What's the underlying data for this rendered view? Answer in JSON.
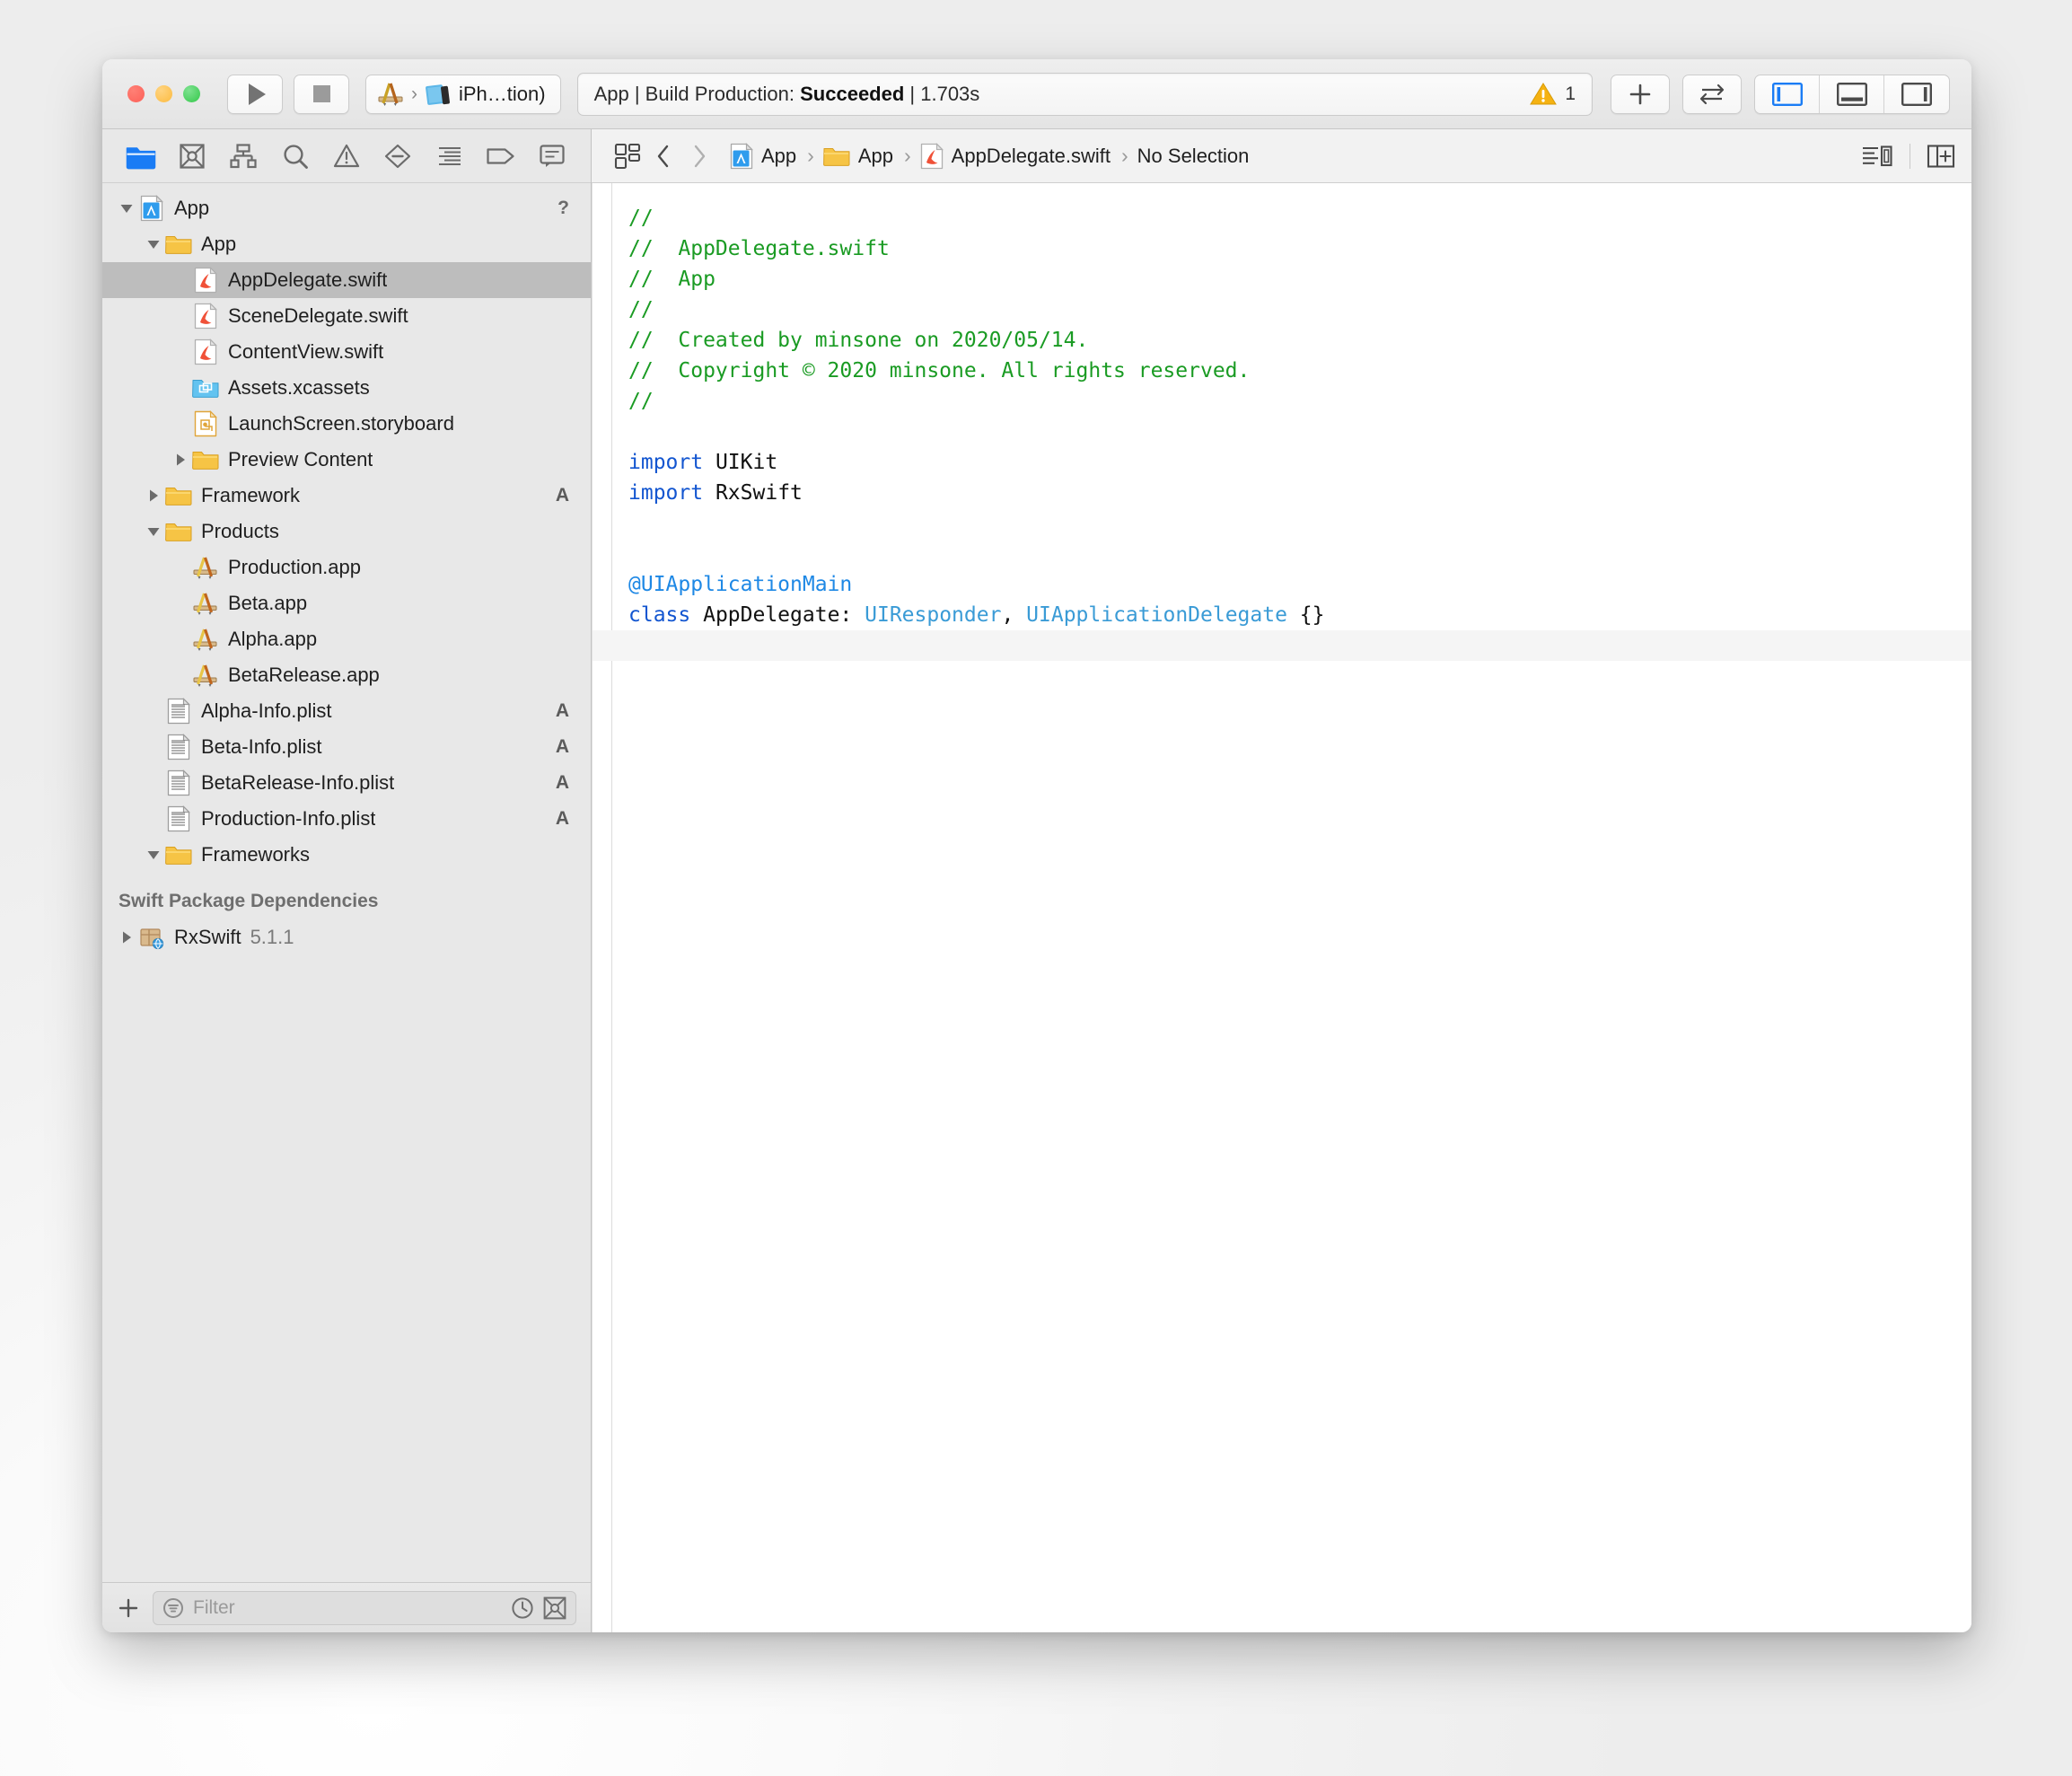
{
  "window": {
    "traffic_lights": [
      "close",
      "minimize",
      "zoom"
    ]
  },
  "toolbar": {
    "run_label": "Run",
    "stop_label": "Stop",
    "scheme": {
      "project": "App",
      "separator": "›",
      "destination": "iPh…tion)"
    },
    "status": {
      "prefix": "App | Build Production: ",
      "result": "Succeeded",
      "suffix": " | 1.703s",
      "warning_count": "1",
      "warning_color": "#f5b211"
    },
    "add_label": "+",
    "navigate_label": "⇄",
    "panel_toggles": [
      {
        "name": "navigator-toggle",
        "active": true
      },
      {
        "name": "debug-area-toggle",
        "active": false
      },
      {
        "name": "inspector-toggle",
        "active": false
      }
    ],
    "accent_color": "#1a7cf5"
  },
  "navigator": {
    "tabs": [
      {
        "name": "project-navigator",
        "label": "Project",
        "active": true
      },
      {
        "name": "source-control-navigator",
        "label": "Source Control",
        "active": false
      },
      {
        "name": "symbol-navigator",
        "label": "Symbol",
        "active": false
      },
      {
        "name": "find-navigator",
        "label": "Find",
        "active": false
      },
      {
        "name": "issue-navigator",
        "label": "Issue",
        "active": false
      },
      {
        "name": "test-navigator",
        "label": "Test",
        "active": false
      },
      {
        "name": "debug-navigator",
        "label": "Debug",
        "active": false
      },
      {
        "name": "breakpoint-navigator",
        "label": "Breakpoint",
        "active": false
      },
      {
        "name": "report-navigator",
        "label": "Report",
        "active": false
      }
    ],
    "tree": [
      {
        "label": "App",
        "icon": "xcode-project-icon",
        "indent": 0,
        "disclosure": "open",
        "badge": "?",
        "selected": false
      },
      {
        "label": "App",
        "icon": "folder-icon",
        "indent": 1,
        "disclosure": "open",
        "badge": "",
        "selected": false
      },
      {
        "label": "AppDelegate.swift",
        "icon": "swift-file-icon",
        "indent": 2,
        "disclosure": "none",
        "badge": "",
        "selected": true
      },
      {
        "label": "SceneDelegate.swift",
        "icon": "swift-file-icon",
        "indent": 2,
        "disclosure": "none",
        "badge": "",
        "selected": false
      },
      {
        "label": "ContentView.swift",
        "icon": "swift-file-icon",
        "indent": 2,
        "disclosure": "none",
        "badge": "",
        "selected": false
      },
      {
        "label": "Assets.xcassets",
        "icon": "assets-icon",
        "indent": 2,
        "disclosure": "none",
        "badge": "",
        "selected": false
      },
      {
        "label": "LaunchScreen.storyboard",
        "icon": "storyboard-icon",
        "indent": 2,
        "disclosure": "none",
        "badge": "",
        "selected": false
      },
      {
        "label": "Preview Content",
        "icon": "folder-icon",
        "indent": 2,
        "disclosure": "closed",
        "badge": "",
        "selected": false
      },
      {
        "label": "Framework",
        "icon": "folder-icon",
        "indent": 1,
        "disclosure": "closed",
        "badge": "A",
        "selected": false
      },
      {
        "label": "Products",
        "icon": "folder-icon",
        "indent": 1,
        "disclosure": "open",
        "badge": "",
        "selected": false
      },
      {
        "label": "Production.app",
        "icon": "app-product-icon",
        "indent": 2,
        "disclosure": "none",
        "badge": "",
        "selected": false
      },
      {
        "label": "Beta.app",
        "icon": "app-product-icon",
        "indent": 2,
        "disclosure": "none",
        "badge": "",
        "selected": false
      },
      {
        "label": "Alpha.app",
        "icon": "app-product-icon",
        "indent": 2,
        "disclosure": "none",
        "badge": "",
        "selected": false
      },
      {
        "label": "BetaRelease.app",
        "icon": "app-product-icon",
        "indent": 2,
        "disclosure": "none",
        "badge": "",
        "selected": false
      },
      {
        "label": "Alpha-Info.plist",
        "icon": "plist-icon",
        "indent": 1,
        "disclosure": "none",
        "badge": "A",
        "selected": false
      },
      {
        "label": "Beta-Info.plist",
        "icon": "plist-icon",
        "indent": 1,
        "disclosure": "none",
        "badge": "A",
        "selected": false
      },
      {
        "label": "BetaRelease-Info.plist",
        "icon": "plist-icon",
        "indent": 1,
        "disclosure": "none",
        "badge": "A",
        "selected": false
      },
      {
        "label": "Production-Info.plist",
        "icon": "plist-icon",
        "indent": 1,
        "disclosure": "none",
        "badge": "A",
        "selected": false
      },
      {
        "label": "Frameworks",
        "icon": "folder-icon",
        "indent": 1,
        "disclosure": "open",
        "badge": "",
        "selected": false
      }
    ],
    "section_header": "Swift Package Dependencies",
    "packages": [
      {
        "label": "RxSwift",
        "version": "5.1.1",
        "icon": "package-icon",
        "disclosure": "closed"
      }
    ],
    "filter": {
      "placeholder": "Filter",
      "add_label": "+",
      "recent_icon": "clock-icon",
      "scm_icon": "source-control-icon"
    },
    "selection_color": "#bdbdbd",
    "background_color": "#e8e8e8"
  },
  "editor": {
    "jumpbar": {
      "related_items_icon": "related-items-icon",
      "back_label": "‹",
      "forward_label": "›",
      "breadcrumbs": [
        {
          "label": "App",
          "icon": "xcode-project-icon"
        },
        {
          "label": "App",
          "icon": "folder-icon"
        },
        {
          "label": "AppDelegate.swift",
          "icon": "swift-file-icon"
        },
        {
          "label": "No Selection",
          "icon": ""
        }
      ],
      "separator": "›",
      "minimap_icon": "minimap-icon",
      "add-editor_icon": "add-editor-icon"
    },
    "code_lines": [
      {
        "type": "comment",
        "text": "//"
      },
      {
        "type": "comment",
        "text": "//  AppDelegate.swift"
      },
      {
        "type": "comment",
        "text": "//  App"
      },
      {
        "type": "comment",
        "text": "//"
      },
      {
        "type": "comment",
        "text": "//  Created by minsone on 2020/05/14."
      },
      {
        "type": "comment",
        "text": "//  Copyright © 2020 minsone. All rights reserved."
      },
      {
        "type": "comment",
        "text": "//"
      },
      {
        "type": "blank",
        "text": ""
      },
      {
        "type": "import",
        "keyword": "import",
        "module": "UIKit"
      },
      {
        "type": "import",
        "keyword": "import",
        "module": "RxSwift"
      },
      {
        "type": "blank",
        "text": ""
      },
      {
        "type": "blank",
        "text": ""
      },
      {
        "type": "attribute",
        "text": "@UIApplicationMain"
      },
      {
        "type": "class_decl",
        "keyword": "class",
        "name": " AppDelegate: ",
        "super1": "UIResponder",
        "comma": ", ",
        "super2": "UIApplicationDelegate",
        "braces": " {}"
      },
      {
        "type": "current",
        "text": ""
      }
    ],
    "colors": {
      "comment": "#1a9b23",
      "keyword": "#1255d0",
      "type": "#3a9bd6",
      "attribute": "#1e88e5",
      "plain": "#111111",
      "background": "#ffffff",
      "current_line": "#f5f5f5"
    }
  }
}
